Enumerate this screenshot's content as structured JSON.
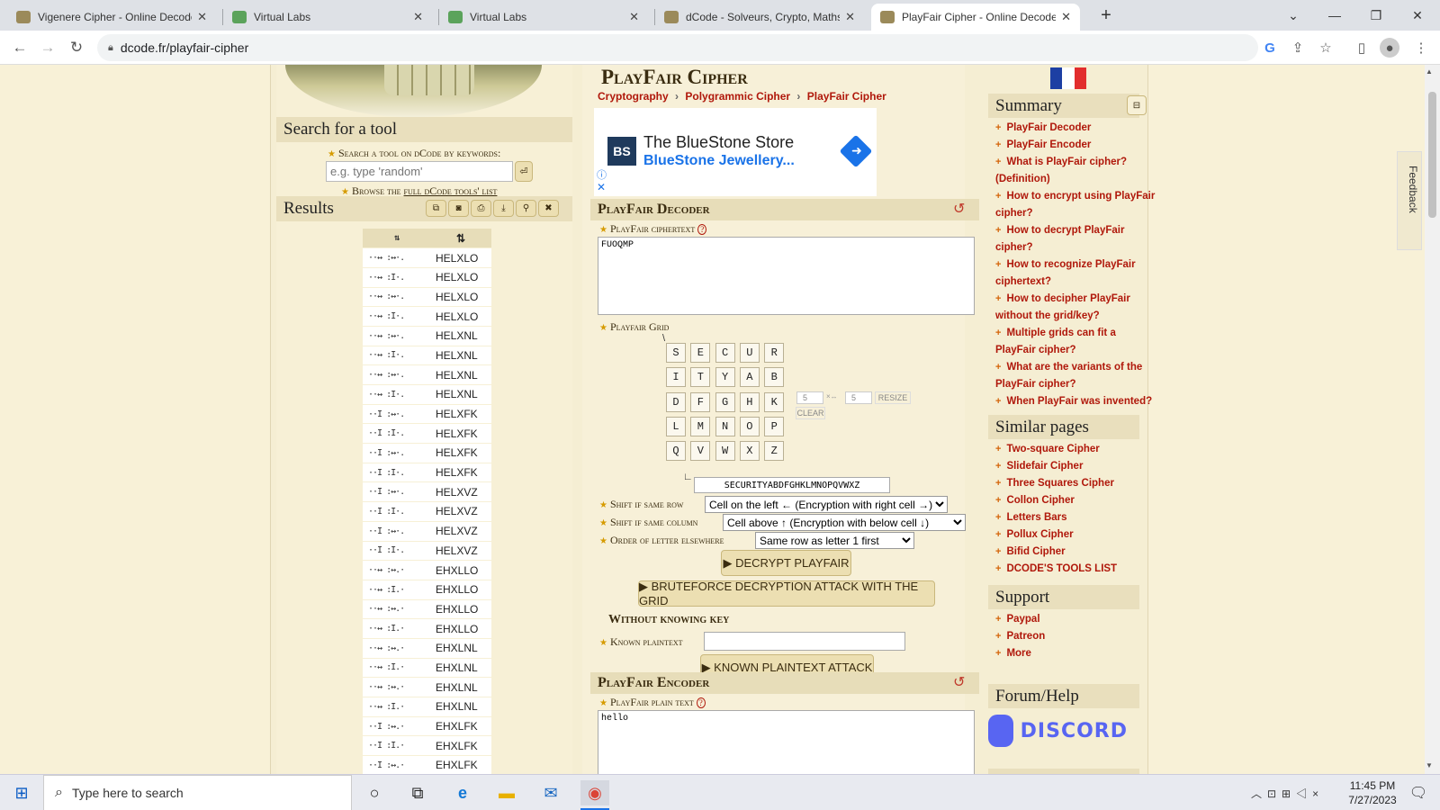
{
  "browser": {
    "tabs": [
      {
        "title": "Vigenere Cipher - Online Decode",
        "active": false
      },
      {
        "title": "Virtual Labs",
        "active": false
      },
      {
        "title": "Virtual Labs",
        "active": false
      },
      {
        "title": "dCode - Solveurs, Crypto, Maths,",
        "active": false
      },
      {
        "title": "PlayFair Cipher - Online Decoder,",
        "active": true
      }
    ],
    "new_tab_icon": "plus-icon",
    "url": "dcode.fr/playfair-cipher"
  },
  "left": {
    "search_title": "Search for a tool",
    "search_hint": "Search a tool on dCode by keywords:",
    "search_placeholder": "e.g. type 'random'",
    "browse_prefix": "Browse the",
    "browse_link": "full dCode tools' list",
    "results_title": "Results",
    "col1_header": "⇅",
    "col2_header": "⇅",
    "results": [
      {
        "pattern": "··↔ :↔·.",
        "text": "HELXLO"
      },
      {
        "pattern": "··↔ :I·.",
        "text": "HELXLO"
      },
      {
        "pattern": "··↔ :↔·.",
        "text": "HELXLO"
      },
      {
        "pattern": "··↔ :I·.",
        "text": "HELXLO"
      },
      {
        "pattern": "··↔ :↔·.",
        "text": "HELXNL"
      },
      {
        "pattern": "··↔ :I·.",
        "text": "HELXNL"
      },
      {
        "pattern": "··↔ :↔·.",
        "text": "HELXNL"
      },
      {
        "pattern": "··↔ :I·.",
        "text": "HELXNL"
      },
      {
        "pattern": "··I :↔·.",
        "text": "HELXFK"
      },
      {
        "pattern": "··I :I·.",
        "text": "HELXFK"
      },
      {
        "pattern": "··I :↔·.",
        "text": "HELXFK"
      },
      {
        "pattern": "··I :I·.",
        "text": "HELXFK"
      },
      {
        "pattern": "··I :↔·.",
        "text": "HELXVZ"
      },
      {
        "pattern": "··I :I·.",
        "text": "HELXVZ"
      },
      {
        "pattern": "··I :↔·.",
        "text": "HELXVZ"
      },
      {
        "pattern": "··I :I·.",
        "text": "HELXVZ"
      },
      {
        "pattern": "··↔ :↔.·",
        "text": "EHXLLO"
      },
      {
        "pattern": "··↔ :I.·",
        "text": "EHXLLO"
      },
      {
        "pattern": "··↔ :↔.·",
        "text": "EHXLLO"
      },
      {
        "pattern": "··↔ :I.·",
        "text": "EHXLLO"
      },
      {
        "pattern": "··↔ :↔.·",
        "text": "EHXLNL"
      },
      {
        "pattern": "··↔ :I.·",
        "text": "EHXLNL"
      },
      {
        "pattern": "··↔ :↔.·",
        "text": "EHXLNL"
      },
      {
        "pattern": "··↔ :I.·",
        "text": "EHXLNL"
      },
      {
        "pattern": "··I :↔.·",
        "text": "EHXLFK"
      },
      {
        "pattern": "··I :I.·",
        "text": "EHXLFK"
      },
      {
        "pattern": "··I :↔.·",
        "text": "EHXLFK"
      }
    ]
  },
  "main": {
    "title": "PlayFair Cipher",
    "breadcrumb": [
      "Cryptography",
      "Polygrammic Cipher",
      "PlayFair Cipher"
    ],
    "ad": {
      "title": "The BlueStone Store",
      "subtitle": "BlueStone Jewellery..."
    },
    "decoder": {
      "title": "PlayFair Decoder",
      "ciphertext_label": "PlayFair ciphertext",
      "ciphertext_value": "FUOQMP",
      "grid_label": "Playfair Grid",
      "grid": [
        [
          "S",
          "E",
          "C",
          "U",
          "R"
        ],
        [
          "I",
          "T",
          "Y",
          "A",
          "B"
        ],
        [
          "D",
          "F",
          "G",
          "H",
          "K"
        ],
        [
          "L",
          "M",
          "N",
          "O",
          "P"
        ],
        [
          "Q",
          "V",
          "W",
          "X",
          "Z"
        ]
      ],
      "rows": "5",
      "cols": "5",
      "resize": "RESIZE",
      "clear": "CLEAR",
      "key_value": "SECURITYABDFGHKLMNOPQVWXZ",
      "shift_row_label": "Shift if same row",
      "shift_row_value": "Cell on the left ← (Encryption with right cell →)",
      "shift_col_label": "Shift if same column",
      "shift_col_value": "Cell above ↑ (Encryption with below cell ↓)",
      "order_label": "Order of letter elsewhere",
      "order_value": "Same row as letter 1 first",
      "decrypt_button": "▶ DECRYPT PLAYFAIR",
      "bruteforce_button": "▶ BRUTEFORCE DECRYPTION ATTACK WITH THE GRID",
      "without_key_title": "Without knowing key",
      "known_label": "Known plaintext",
      "known_button": "▶ KNOWN PLAINTEXT ATTACK"
    },
    "encoder": {
      "title": "PlayFair Encoder",
      "plaintext_label": "PlayFair plain text",
      "plaintext_value": "hello"
    }
  },
  "right": {
    "summary_title": "Summary",
    "summary_links": [
      "PlayFair Decoder",
      "PlayFair Encoder",
      "What is PlayFair cipher? (Definition)",
      "How to encrypt using PlayFair cipher?",
      "How to decrypt PlayFair cipher?",
      "How to recognize PlayFair ciphertext?",
      "How to decipher PlayFair without the grid/key?",
      "Multiple grids can fit a PlayFair cipher?",
      "What are the variants of the PlayFair cipher?",
      "When PlayFair was invented?"
    ],
    "similar_title": "Similar pages",
    "similar_links": [
      "Two-square Cipher",
      "Slidefair Cipher",
      "Three Squares Cipher",
      "Collon Cipher",
      "Letters Bars",
      "Pollux Cipher",
      "Bifid Cipher",
      "DCODE'S TOOLS LIST"
    ],
    "support_title": "Support",
    "support_links": [
      "Paypal",
      "Patreon",
      "More"
    ],
    "forum_title": "Forum/Help",
    "discord": "DISCORD",
    "feedback": "Feedback"
  },
  "taskbar": {
    "search_placeholder": "Type here to search",
    "time": "11:45 PM",
    "date": "7/27/2023"
  }
}
